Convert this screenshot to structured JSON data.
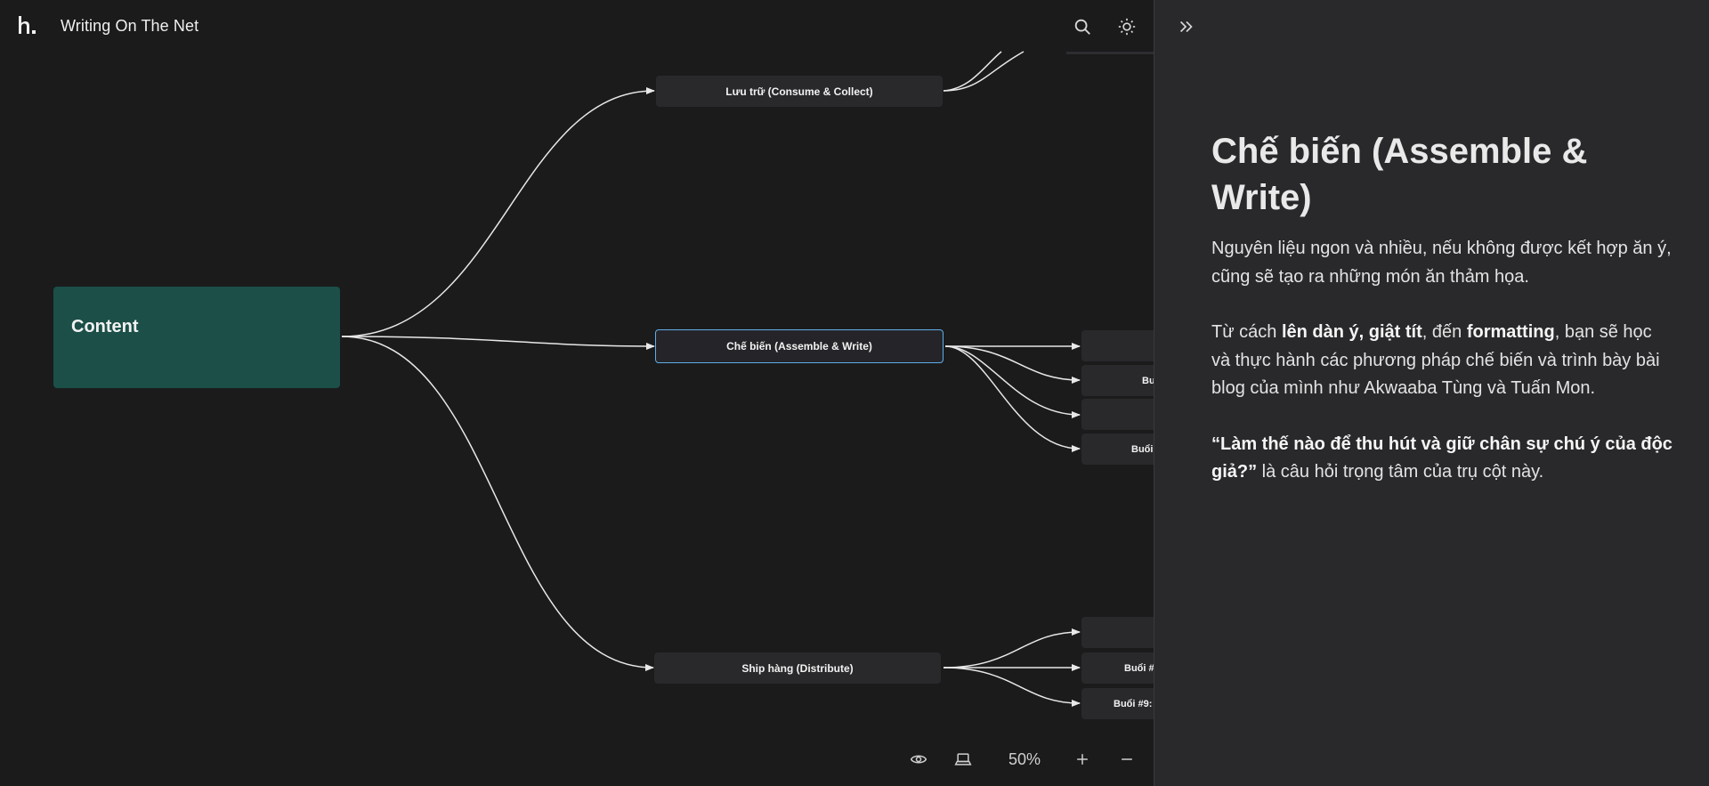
{
  "app": {
    "title": "Writing On The Net",
    "logo_icon": "logo-h-icon"
  },
  "toolbar": {
    "search_icon": "search-icon",
    "theme_icon": "sun-icon"
  },
  "mindmap": {
    "root": "Content",
    "branches": [
      {
        "label": "Lưu trữ (Consume & Collect)"
      },
      {
        "label": "Chế biến (Assemble & Write)",
        "selected": true
      },
      {
        "label": "Ship hàng (Distribute)"
      }
    ],
    "leaves": {
      "write": [
        "",
        "Bu",
        "",
        "Buổi"
      ],
      "distribute": [
        "",
        "Buổi #",
        "Buổi #9:"
      ]
    }
  },
  "bottom": {
    "preview_icon": "eye-icon",
    "present_icon": "laptop-icon",
    "zoom": "50%",
    "zoom_in_icon": "plus-icon",
    "zoom_out_icon": "minus-icon"
  },
  "panel": {
    "collapse_icon": "double-chevron-right-icon",
    "title": "Chế biến (Assemble & Write)",
    "p1": "Nguyên liệu ngon và nhiều, nếu không được kết hợp ăn ý, cũng sẽ tạo ra những món ăn thảm họa.",
    "p2": {
      "t1": "Từ cách ",
      "b1": "lên dàn ý, giật tít",
      "t2": ", đến ",
      "b2": "formatting",
      "t3": ", bạn sẽ học và thực hành các phương pháp chế biến và trình bày bài blog của mình như Akwaaba Tùng và Tuấn Mon."
    },
    "p3": {
      "b1": "“Làm thế nào để thu hút và giữ chân sự chú ý của độc giả?”",
      "t1": " là câu hỏi trọng tâm của trụ cột này."
    }
  },
  "colors": {
    "background": "#1b1b1c",
    "node": "#29292c",
    "root_node": "#1b4f48",
    "selected_border": "#5eaee8",
    "panel": "#29292c"
  }
}
